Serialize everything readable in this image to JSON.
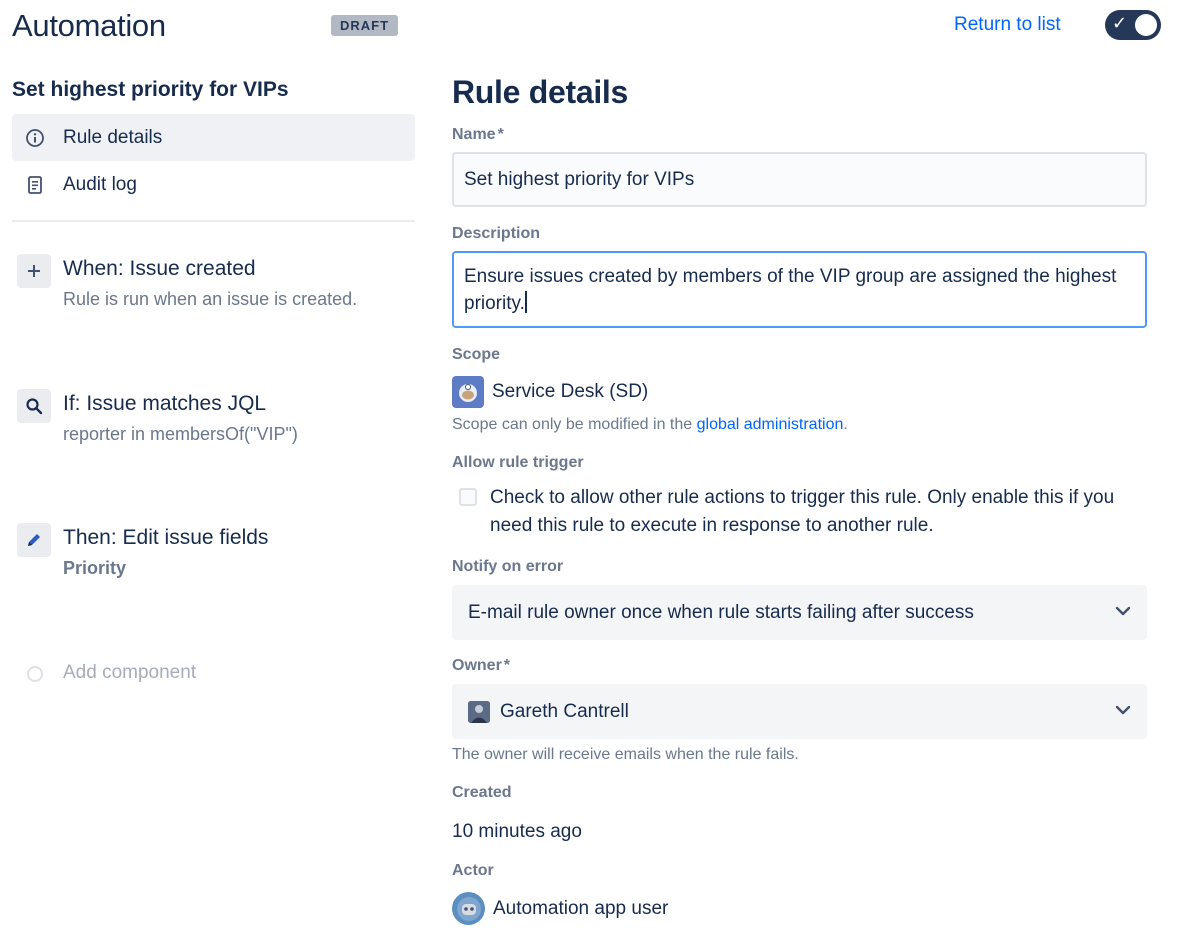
{
  "header": {
    "title": "Automation",
    "badge": "DRAFT",
    "return_link": "Return to list",
    "toggle_state": "enabled"
  },
  "sidebar": {
    "rule_name": "Set highest priority for VIPs",
    "nav": [
      {
        "label": "Rule details",
        "icon": "info-icon",
        "active": true
      },
      {
        "label": "Audit log",
        "icon": "document-icon",
        "active": false
      }
    ],
    "components": [
      {
        "icon": "plus-icon",
        "title": "When: Issue created",
        "subtitle": "Rule is run when an issue is created."
      },
      {
        "icon": "search-icon",
        "title": "If: Issue matches JQL",
        "subtitle": "reporter in membersOf(\"VIP\")"
      },
      {
        "icon": "pencil-icon",
        "title": "Then: Edit issue fields",
        "subtitle": "Priority"
      }
    ],
    "add_component": "Add component"
  },
  "panel": {
    "title": "Rule details",
    "name": {
      "label": "Name",
      "required": "*",
      "value": "Set highest priority for VIPs"
    },
    "description": {
      "label": "Description",
      "value": "Ensure issues created by members of the VIP group are assigned the highest priority."
    },
    "scope": {
      "label": "Scope",
      "value": "Service Desk (SD)",
      "helper_prefix": "Scope can only be modified in the ",
      "helper_link": "global administration",
      "helper_suffix": "."
    },
    "allow_trigger": {
      "label": "Allow rule trigger",
      "checkbox_text": "Check to allow other rule actions to trigger this rule. Only enable this if you need this rule to execute in response to another rule.",
      "checked": false
    },
    "notify": {
      "label": "Notify on error",
      "value": "E-mail rule owner once when rule starts failing after success"
    },
    "owner": {
      "label": "Owner",
      "required": "*",
      "value": "Gareth Cantrell",
      "helper": "The owner will receive emails when the rule fails."
    },
    "created": {
      "label": "Created",
      "value": "10 minutes ago"
    },
    "actor": {
      "label": "Actor",
      "value": "Automation app user"
    }
  },
  "colors": {
    "link": "#0065ff",
    "text": "#172b4d",
    "muted": "#6b778c",
    "focus_border": "#4c9aff",
    "toggle_bg": "#253858"
  }
}
